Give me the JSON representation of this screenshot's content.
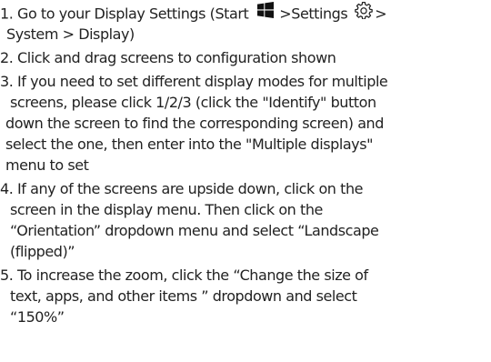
{
  "instructions": {
    "step1": {
      "text_a": "1. Go to your Display Settings (Start",
      "text_b": ">Settings",
      "text_c": ">",
      "text_d": "System > Display)"
    },
    "step2": "2. Click and drag screens to configuration shown",
    "step3": [
      "3. If you need to set different display modes for multiple",
      "screens, please click 1/2/3 (click the \"Identify\" button",
      "down the screen to find the corresponding screen) and",
      "select the one, then enter into the \"Multiple displays\"",
      "menu to set"
    ],
    "step4": [
      "4. If any of the screens are upside down, click on the",
      "screen in the display menu. Then click on the",
      "“Orientation” dropdown menu and select “Landscape",
      "(flipped)”"
    ],
    "step5": [
      "5. To increase the zoom, click the “Change the size of",
      "text, apps, and other items ” dropdown and select",
      "“150%”"
    ]
  },
  "icons": {
    "windows": "windows-logo-icon",
    "settings": "gear-icon"
  },
  "colors": {
    "text": "#222222",
    "background": "#ffffff"
  }
}
